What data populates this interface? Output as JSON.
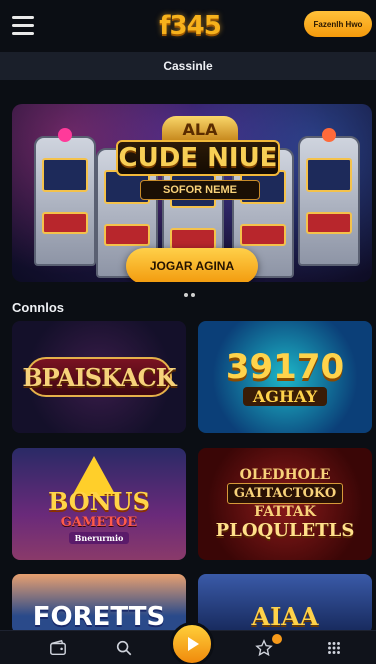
{
  "header": {
    "logo_text": "f345",
    "cta_label": "Fazenlh Hwo"
  },
  "section_bar": {
    "title": "Cassinle"
  },
  "banner": {
    "crown_text": "ALA",
    "title": "CUDE NIUE",
    "subtitle": "SOFOR NEME",
    "cta_label": "JOGAR AGINA"
  },
  "games_section": {
    "title": "Connlos"
  },
  "games": [
    {
      "name": "BPAISKACK"
    },
    {
      "name_big": "39170",
      "name_small": "AGHAY"
    },
    {
      "name_big": "BONUS",
      "name_small": "GAMETOE",
      "name_tiny": "Bnerurmio"
    },
    {
      "line1": "OLEDHOLE",
      "line2": "GATTACTOKO",
      "line3": "PLOQULETLS",
      "line_mid": "FATTAK"
    },
    {
      "name": "FORETTS"
    },
    {
      "name": "AIAA"
    }
  ],
  "bottom_nav": {
    "items": [
      "wallet-icon",
      "search-icon",
      "play-icon",
      "star-icon",
      "grid-icon"
    ]
  },
  "colors": {
    "accent": "#f7b21c",
    "background": "#0b0e14",
    "section_bar": "#1a1f2a"
  }
}
